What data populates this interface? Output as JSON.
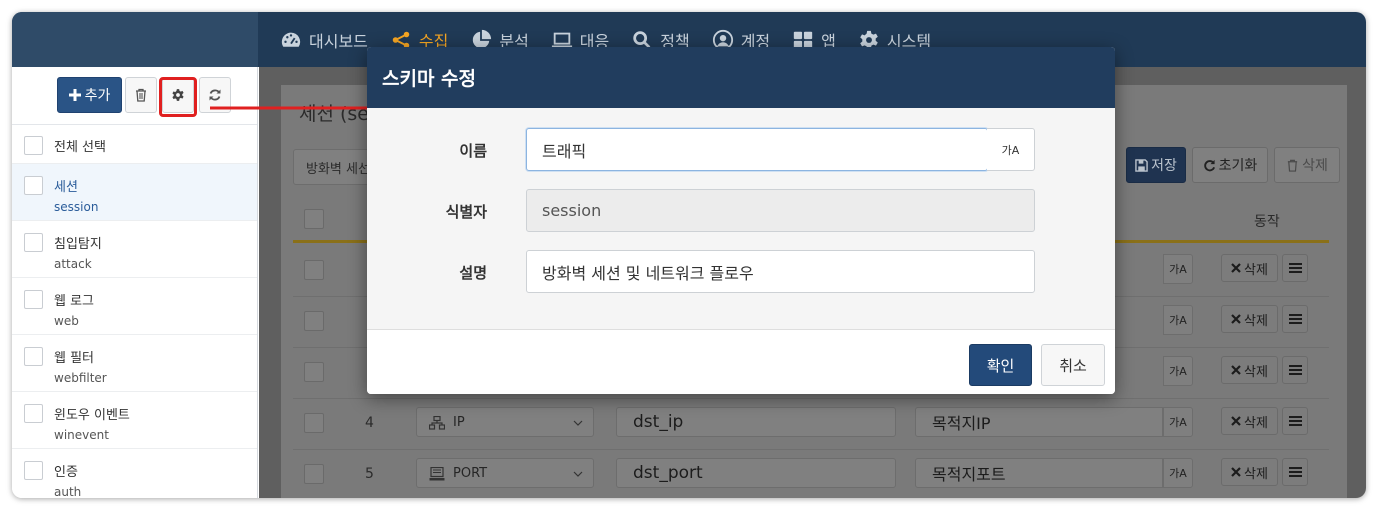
{
  "nav": {
    "items": [
      {
        "label": "대시보드",
        "icon": "dashboard-icon"
      },
      {
        "label": "수집",
        "icon": "share-nodes-icon",
        "active": true
      },
      {
        "label": "분석",
        "icon": "pie-chart-icon"
      },
      {
        "label": "대응",
        "icon": "laptop-icon"
      },
      {
        "label": "정책",
        "icon": "search-icon"
      },
      {
        "label": "계정",
        "icon": "user-circle-icon"
      },
      {
        "label": "앱",
        "icon": "grid-icon"
      },
      {
        "label": "시스템",
        "icon": "gear-icon"
      }
    ]
  },
  "sidebar": {
    "add_label": "추가",
    "select_all": "전체 선택",
    "items": [
      {
        "label": "세션",
        "code": "session",
        "selected": true
      },
      {
        "label": "침입탐지",
        "code": "attack"
      },
      {
        "label": "웹 로그",
        "code": "web"
      },
      {
        "label": "웹 필터",
        "code": "webfilter"
      },
      {
        "label": "윈도우 이벤트",
        "code": "winevent"
      },
      {
        "label": "인증",
        "code": "auth"
      }
    ]
  },
  "main": {
    "title": "세션 (se",
    "filter_text": "방화벽 세선",
    "save_label": "저장",
    "reset_label": "초기화",
    "delete_label": "삭제",
    "col_action": "동작",
    "rows": [
      {
        "num": "",
        "type": "",
        "name": "",
        "desc": ""
      },
      {
        "num": "",
        "type": "",
        "name": "",
        "desc": ""
      },
      {
        "num": "",
        "type": "",
        "name": "",
        "desc": ""
      },
      {
        "num": "4",
        "type": "IP",
        "name": "dst_ip",
        "desc": "목적지IP"
      },
      {
        "num": "5",
        "type": "PORT",
        "name": "dst_port",
        "desc": "목적지포트"
      }
    ],
    "row_delete_label": "삭제",
    "korean_toggle": "가A"
  },
  "modal": {
    "title": "스키마 수정",
    "name_label": "이름",
    "name_value": "트래픽",
    "id_label": "식별자",
    "id_value": "session",
    "desc_label": "설명",
    "desc_value": "방화벽 세션 및 네트워크 플로우",
    "korean_toggle": "가A",
    "ok_label": "확인",
    "cancel_label": "취소"
  },
  "colors": {
    "topbar": "#203a56",
    "accent_active": "#f6a623",
    "primary_button": "#2a5486",
    "highlight": "#e02020"
  }
}
